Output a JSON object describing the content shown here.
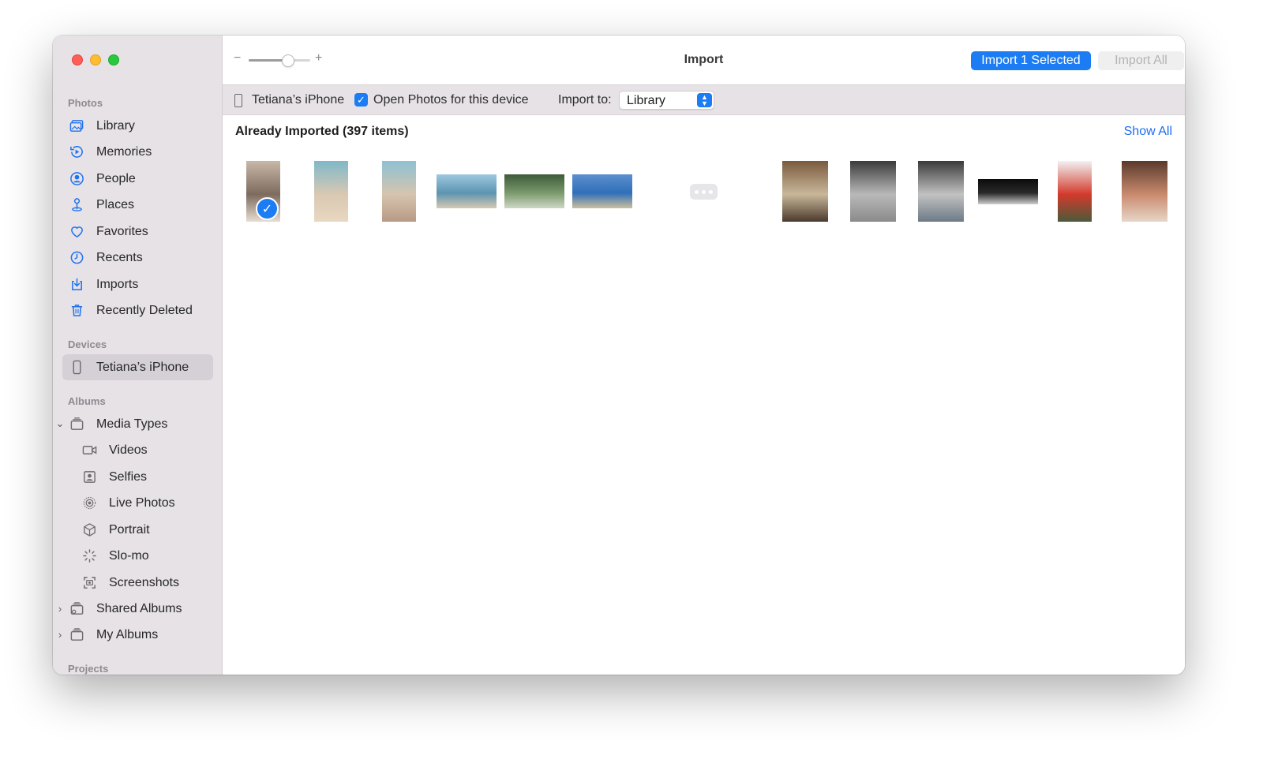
{
  "window": {
    "title": "Import"
  },
  "sidebar": {
    "sections": {
      "photos": "Photos",
      "devices": "Devices",
      "albums": "Albums",
      "projects": "Projects"
    },
    "photos_items": [
      {
        "label": "Library",
        "icon": "library-icon"
      },
      {
        "label": "Memories",
        "icon": "memories-icon"
      },
      {
        "label": "People",
        "icon": "people-icon"
      },
      {
        "label": "Places",
        "icon": "places-icon"
      },
      {
        "label": "Favorites",
        "icon": "heart-icon"
      },
      {
        "label": "Recents",
        "icon": "clock-icon"
      },
      {
        "label": "Imports",
        "icon": "import-icon"
      },
      {
        "label": "Recently Deleted",
        "icon": "trash-icon"
      }
    ],
    "device_item": {
      "label": "Tetiana’s iPhone",
      "icon": "iphone-icon",
      "selected": true
    },
    "album_items": [
      {
        "label": "Media Types",
        "icon": "album-stack-icon",
        "expanded": true
      },
      {
        "label": "Videos",
        "icon": "video-icon"
      },
      {
        "label": "Selfies",
        "icon": "selfie-icon"
      },
      {
        "label": "Live Photos",
        "icon": "live-photo-icon"
      },
      {
        "label": "Portrait",
        "icon": "portrait-cube-icon"
      },
      {
        "label": "Slo-mo",
        "icon": "slomo-icon"
      },
      {
        "label": "Screenshots",
        "icon": "screenshot-icon"
      },
      {
        "label": "Shared Albums",
        "icon": "shared-album-icon",
        "expanded": false
      },
      {
        "label": "My Albums",
        "icon": "album-stack-icon",
        "expanded": false
      }
    ]
  },
  "toolbar": {
    "zoom_minus": "−",
    "zoom_plus": "+",
    "zoom_level": 0.68,
    "import_selected_label": "Import 1 Selected",
    "import_all_label": "Import All"
  },
  "device_bar": {
    "device_name": "Tetiana’s iPhone",
    "open_photos_checked": true,
    "open_photos_label": "Open Photos for this device",
    "import_to_label": "Import to:",
    "import_to_value": "Library"
  },
  "content": {
    "already_imported_label": "Already Imported (397 items)",
    "show_all_label": "Show All",
    "thumbnails": [
      {
        "kind": "portrait",
        "selected": true,
        "colors": [
          "#c9b8a8",
          "#7d6b5e",
          "#e8ddd2"
        ]
      },
      {
        "kind": "portrait",
        "selected": false,
        "colors": [
          "#7fb8c9",
          "#d9c8b2",
          "#e9d8c0"
        ]
      },
      {
        "kind": "portrait",
        "selected": false,
        "colors": [
          "#8ec1d3",
          "#d6c4ae",
          "#b89a86"
        ]
      },
      {
        "kind": "landscape",
        "selected": false,
        "colors": [
          "#9ec8e0",
          "#5c94b0",
          "#d7c9b2"
        ]
      },
      {
        "kind": "landscape",
        "selected": false,
        "colors": [
          "#3e5a3a",
          "#7b9a6c",
          "#cfd7c6"
        ]
      },
      {
        "kind": "landscape",
        "selected": false,
        "colors": [
          "#5d8fd0",
          "#2f6fb8",
          "#cdbf9d"
        ]
      },
      {
        "kind": "square",
        "selected": false,
        "colors": [
          "#7a5a3e",
          "#c9b79a",
          "#4b3a2c"
        ]
      },
      {
        "kind": "square",
        "selected": false,
        "colors": [
          "#3b3b3b",
          "#b9b9b9",
          "#8a8a8a"
        ]
      },
      {
        "kind": "square",
        "selected": false,
        "colors": [
          "#3a3a3a",
          "#c2c2c2",
          "#6c7a86"
        ]
      },
      {
        "kind": "wide-dark",
        "selected": false,
        "colors": [
          "#0b0b0b",
          "#2a2a2a",
          "#cfcfcf"
        ]
      },
      {
        "kind": "portrait",
        "selected": false,
        "colors": [
          "#f2f2f2",
          "#d33a2c",
          "#4a5a3a"
        ]
      },
      {
        "kind": "square",
        "selected": false,
        "colors": [
          "#5a3a2c",
          "#c98a6e",
          "#e7d6c8"
        ]
      }
    ],
    "more_button": "more-dots-icon"
  },
  "colors": {
    "accent": "#1b7cf3",
    "sidebar_bg": "#e6e2e6",
    "link": "#1b6ff0"
  }
}
